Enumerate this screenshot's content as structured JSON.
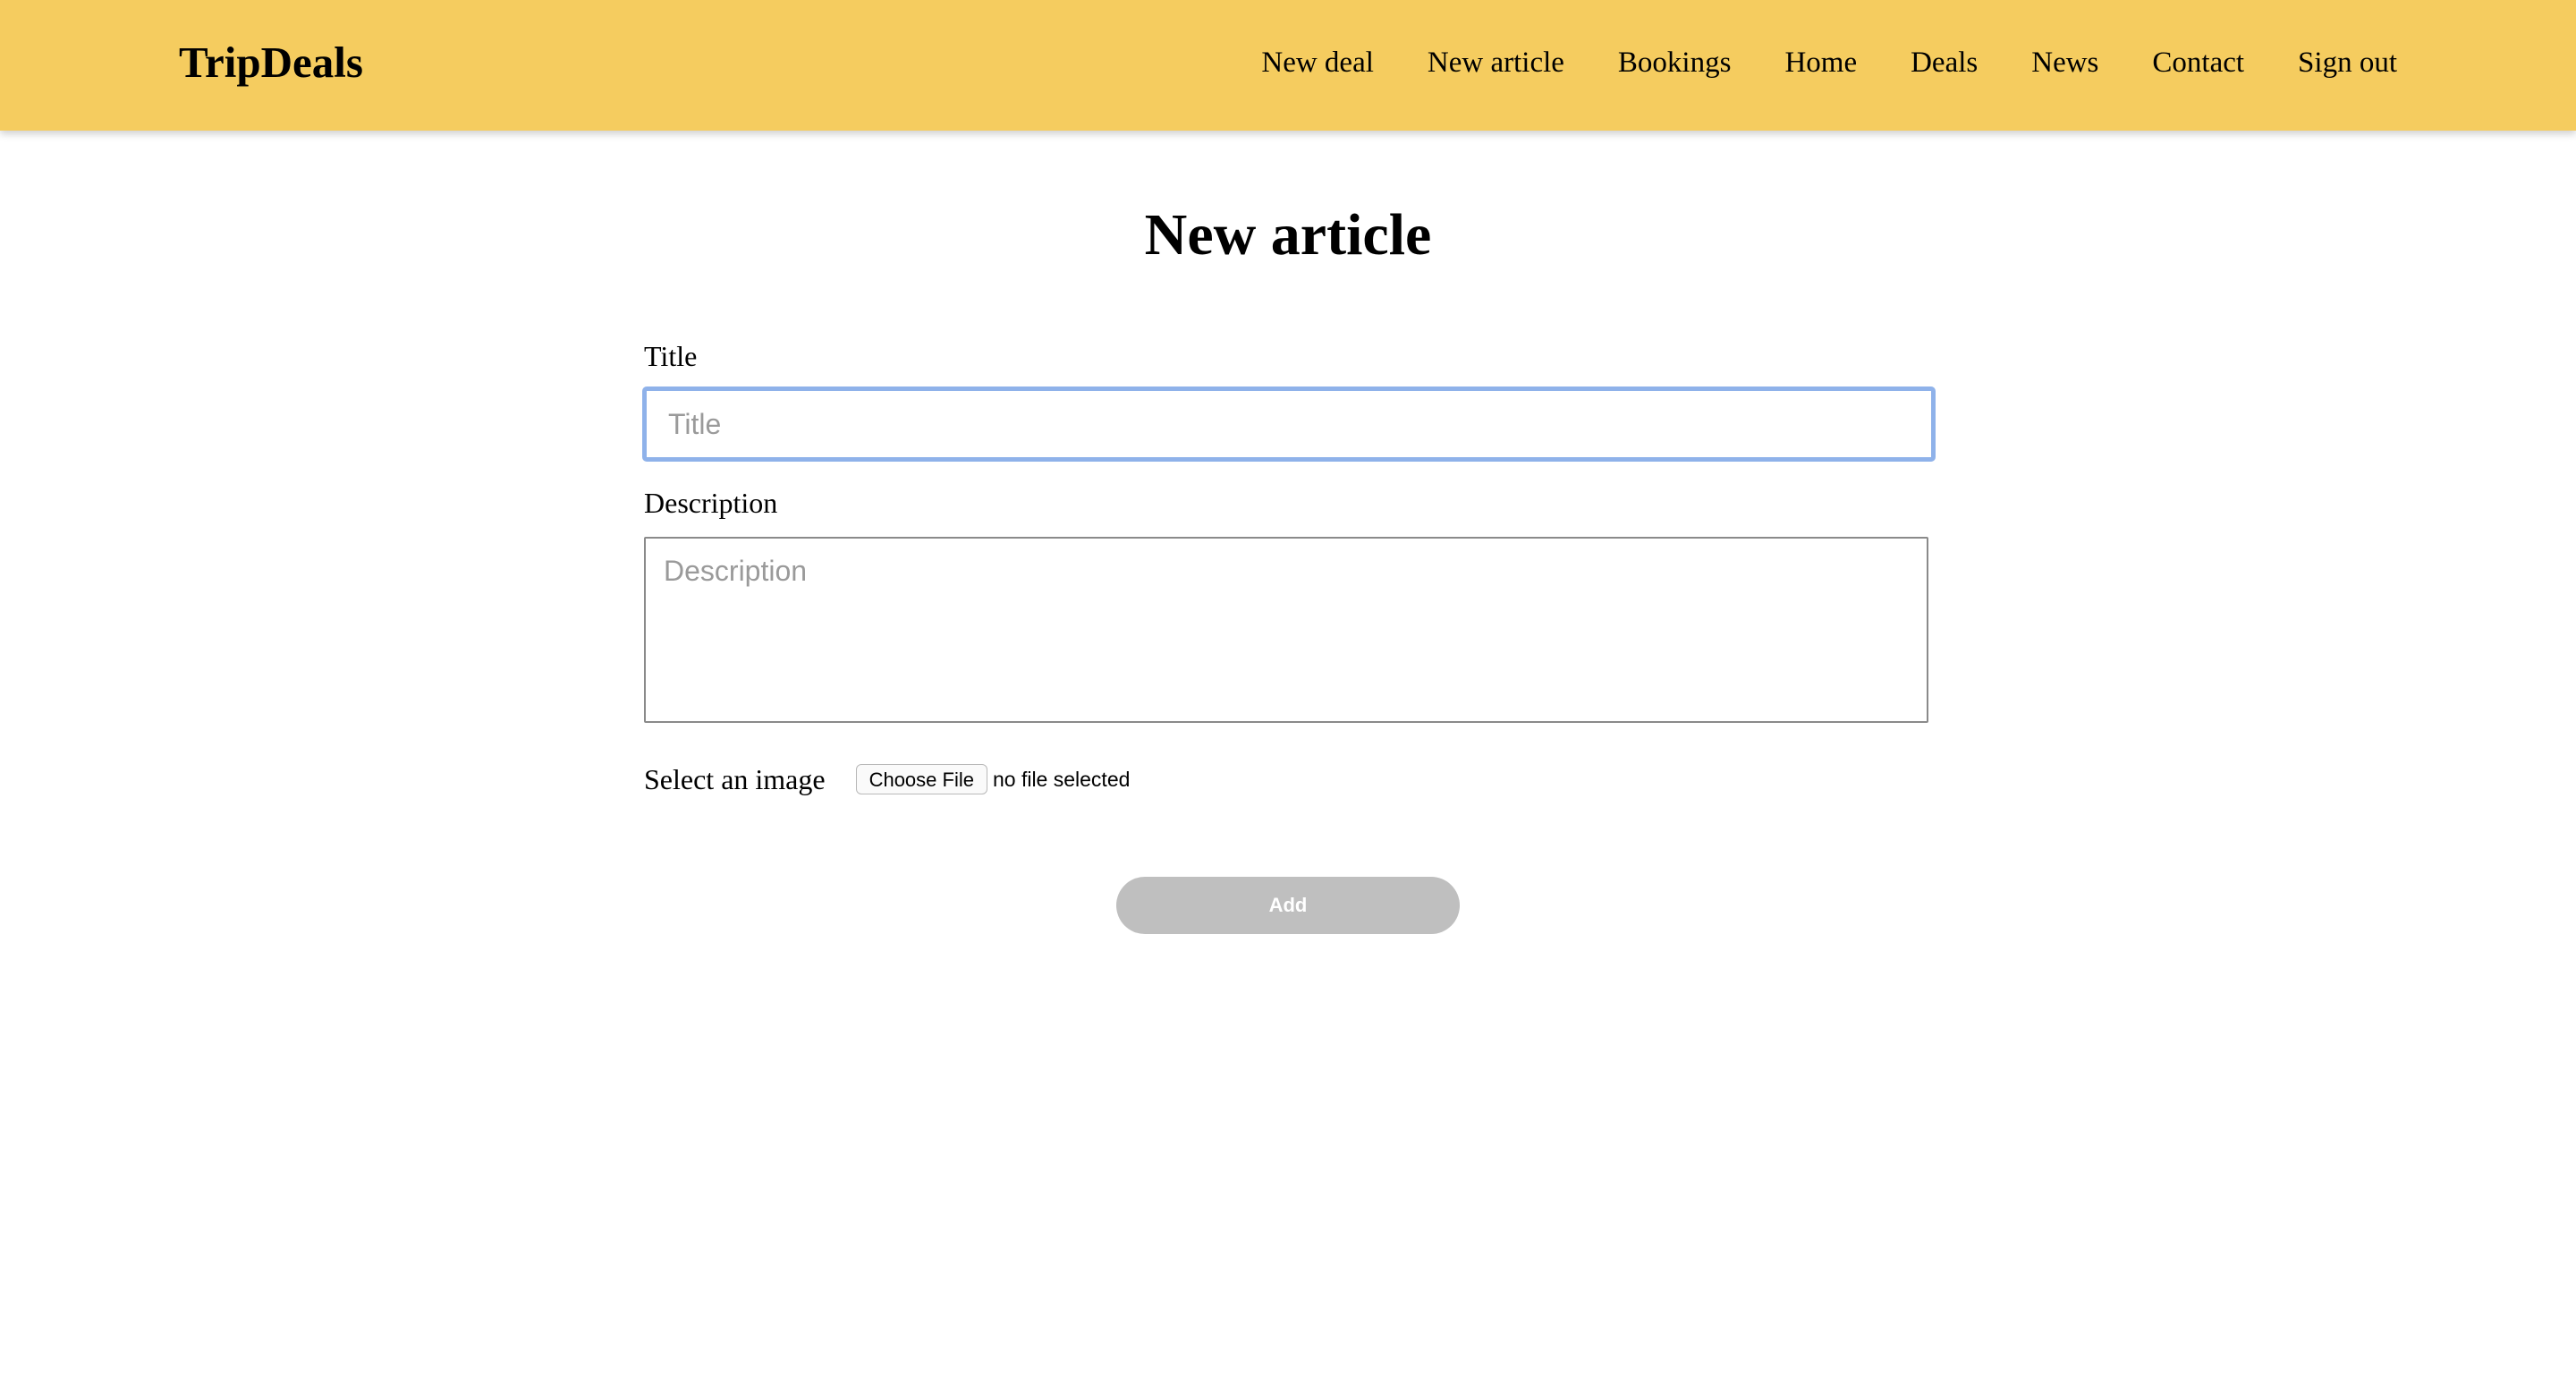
{
  "header": {
    "brand": "TripDeals",
    "background_color": "#f5cc5f",
    "nav": [
      {
        "label": "New deal"
      },
      {
        "label": "New article"
      },
      {
        "label": "Bookings"
      },
      {
        "label": "Home"
      },
      {
        "label": "Deals"
      },
      {
        "label": "News"
      },
      {
        "label": "Contact"
      },
      {
        "label": "Sign out"
      }
    ]
  },
  "main": {
    "title": "New article",
    "form": {
      "title_label": "Title",
      "title_placeholder": "Title",
      "title_value": "",
      "description_label": "Description",
      "description_placeholder": "Description",
      "description_value": "",
      "image_label": "Select an image",
      "choose_file_label": "Choose File",
      "file_status": "no file selected",
      "submit_label": "Add",
      "submit_color": "#bfbfbf",
      "focus_color": "#8fb2ea"
    }
  }
}
